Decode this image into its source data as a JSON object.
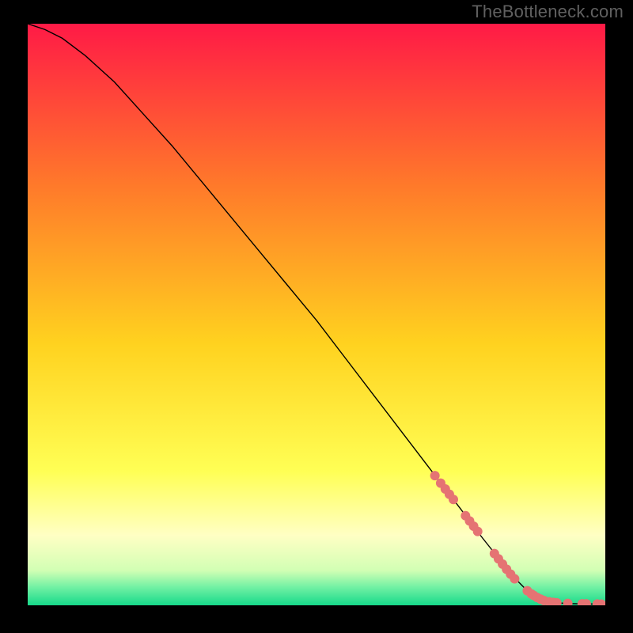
{
  "watermark": "TheBottleneck.com",
  "chart_data": {
    "type": "line",
    "title": "",
    "xlabel": "",
    "ylabel": "",
    "xlim": [
      0,
      100
    ],
    "ylim": [
      0,
      100
    ],
    "grid": false,
    "legend": false,
    "gradient_stops": [
      {
        "offset": 0,
        "color": "#ff1a46"
      },
      {
        "offset": 28,
        "color": "#ff7a2a"
      },
      {
        "offset": 55,
        "color": "#ffd21f"
      },
      {
        "offset": 77,
        "color": "#ffff55"
      },
      {
        "offset": 88,
        "color": "#ffffc4"
      },
      {
        "offset": 94,
        "color": "#d2ffb4"
      },
      {
        "offset": 97,
        "color": "#6ef0a3"
      },
      {
        "offset": 100,
        "color": "#17d98a"
      }
    ],
    "curve": {
      "name": "bottleneck-curve",
      "color": "#000000",
      "stroke_width": 1.4,
      "points_xy": [
        [
          0,
          100
        ],
        [
          3,
          99
        ],
        [
          6,
          97.5
        ],
        [
          10,
          94.5
        ],
        [
          15,
          90
        ],
        [
          20,
          84.5
        ],
        [
          25,
          79
        ],
        [
          30,
          73
        ],
        [
          35,
          67
        ],
        [
          40,
          61
        ],
        [
          45,
          55
        ],
        [
          50,
          49
        ],
        [
          55,
          42.5
        ],
        [
          60,
          36
        ],
        [
          65,
          29.5
        ],
        [
          70,
          23
        ],
        [
          75,
          16.5
        ],
        [
          78,
          12.5
        ],
        [
          80,
          10
        ],
        [
          82,
          7.5
        ],
        [
          84,
          5
        ],
        [
          86,
          3
        ],
        [
          88,
          1.5
        ],
        [
          90,
          0.7
        ],
        [
          92,
          0.4
        ],
        [
          94,
          0.3
        ],
        [
          96,
          0.25
        ],
        [
          98,
          0.22
        ],
        [
          100,
          0.2
        ]
      ]
    },
    "markers": {
      "name": "highlight-points",
      "color": "#e57373",
      "radius": 6,
      "points_xy": [
        [
          70.5,
          22.3
        ],
        [
          71.5,
          21.0
        ],
        [
          72.3,
          20.0
        ],
        [
          73.0,
          19.1
        ],
        [
          73.7,
          18.2
        ],
        [
          75.8,
          15.4
        ],
        [
          76.5,
          14.5
        ],
        [
          77.2,
          13.6
        ],
        [
          77.9,
          12.7
        ],
        [
          80.8,
          8.9
        ],
        [
          81.5,
          8.0
        ],
        [
          82.2,
          7.1
        ],
        [
          82.9,
          6.2
        ],
        [
          83.6,
          5.35
        ],
        [
          84.3,
          4.55
        ],
        [
          86.5,
          2.5
        ],
        [
          87.2,
          1.95
        ],
        [
          87.6,
          1.7
        ],
        [
          88.2,
          1.35
        ],
        [
          88.8,
          1.05
        ],
        [
          89.4,
          0.82
        ],
        [
          90.3,
          0.6
        ],
        [
          91.0,
          0.5
        ],
        [
          91.6,
          0.43
        ],
        [
          93.5,
          0.33
        ],
        [
          96.0,
          0.26
        ],
        [
          96.7,
          0.25
        ],
        [
          98.6,
          0.22
        ],
        [
          99.3,
          0.21
        ]
      ]
    }
  }
}
